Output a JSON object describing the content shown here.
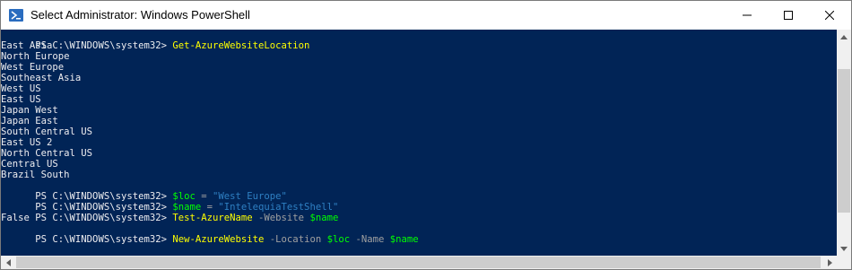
{
  "window": {
    "title": "Select Administrator: Windows PowerShell",
    "icon": "powershell-icon",
    "controls": [
      "minimize-icon",
      "maximize-icon",
      "close-icon"
    ]
  },
  "colors": {
    "console_bg": "#012456",
    "text": "#eeedf0",
    "command": "#ffff00",
    "variable": "#00ff00",
    "string": "#3a96dd",
    "parameter": "#a0a0a0"
  },
  "console": {
    "prompt": "PS C:\\WINDOWS\\system32> ",
    "commands": {
      "get_location": {
        "cmd": "Get-AzureWebsiteLocation"
      },
      "set_loc": {
        "var": "$loc",
        "op": " = ",
        "str": "\"West Europe\""
      },
      "set_name": {
        "var": "$name",
        "op": " = ",
        "str": "\"IntelequiaTestShell\""
      },
      "test_name": {
        "cmd": "Test-AzureName",
        "param": " -Website ",
        "arg": "$name"
      },
      "new_website": {
        "cmd": "New-AzureWebsite",
        "param1": " -Location ",
        "arg1": "$loc",
        "param2": " -Name ",
        "arg2": "$name"
      }
    },
    "locations": [
      "East Asia",
      "North Europe",
      "West Europe",
      "Southeast Asia",
      "West US",
      "East US",
      "Japan West",
      "Japan East",
      "South Central US",
      "East US 2",
      "North Central US",
      "Central US",
      "Brazil South"
    ],
    "test_result": "False"
  },
  "scrollbars": {
    "vertical": [
      "scroll-up-icon",
      "scroll-down-icon"
    ],
    "horizontal": [
      "scroll-left-icon",
      "scroll-right-icon"
    ]
  }
}
